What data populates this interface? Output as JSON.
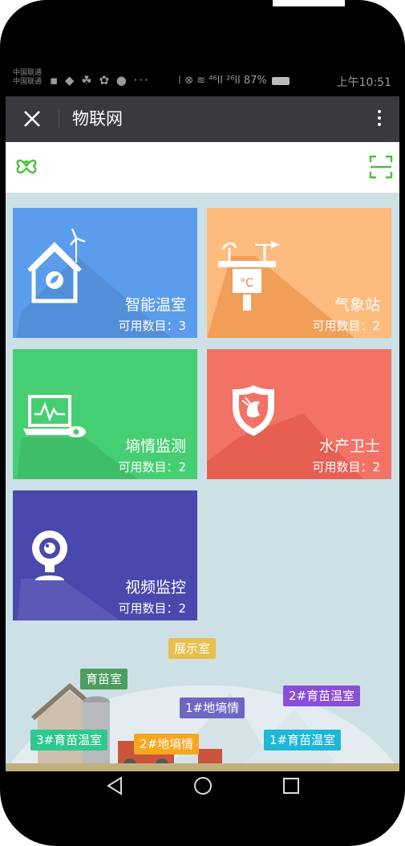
{
  "status_bar": {
    "carrier_1": "中国联通",
    "carrier_2": "中国联通",
    "notif_icons": "▪ ◆ ☘ ✿ ● ···",
    "sys_icons": "⁞ ⊗ ≋ ⁴⁶ll ²⁶ll 87%",
    "battery_percent": "87%",
    "time": "上午10:51"
  },
  "title_bar": {
    "title": "物联网",
    "close_icon": "close-icon",
    "more_icon": "more-vertical-icon"
  },
  "app_header": {
    "logo_icon": "clover-logo-icon",
    "scan_icon": "scan-icon",
    "accent": "#4cbf3f"
  },
  "tiles": [
    {
      "name": "智能温室",
      "count": "可用数目：3",
      "icon": "greenhouse-icon",
      "color": "#5b9cec"
    },
    {
      "name": "气象站",
      "count": "可用数目：2",
      "icon": "weather-station-icon",
      "color": "#fdbb7d"
    },
    {
      "name": "墒情监测",
      "count": "可用数目：2",
      "icon": "soil-monitor-icon",
      "color": "#45cf72"
    },
    {
      "name": "水产卫士",
      "count": "可用数目：2",
      "icon": "aquatic-shield-icon",
      "color": "#f27266"
    },
    {
      "name": "视频监控",
      "count": "可用数目：2",
      "icon": "webcam-icon",
      "color": "#4a47ad"
    }
  ],
  "map_tags": [
    {
      "label": "展示室",
      "color": "#e6c04c"
    },
    {
      "label": "育苗室",
      "color": "#4c9e5c"
    },
    {
      "label": "1#地墒情",
      "color": "#6f66c4"
    },
    {
      "label": "2#育苗温室",
      "color": "#8a4fd8"
    },
    {
      "label": "3#育苗温室",
      "color": "#2fc88e"
    },
    {
      "label": "2#地墒情",
      "color": "#f6a71e"
    },
    {
      "label": "1#育苗温室",
      "color": "#1fb7d6"
    }
  ],
  "nav_bar": {
    "back_icon": "back-triangle-icon",
    "home_icon": "home-circle-icon",
    "recents_icon": "recents-square-icon"
  }
}
